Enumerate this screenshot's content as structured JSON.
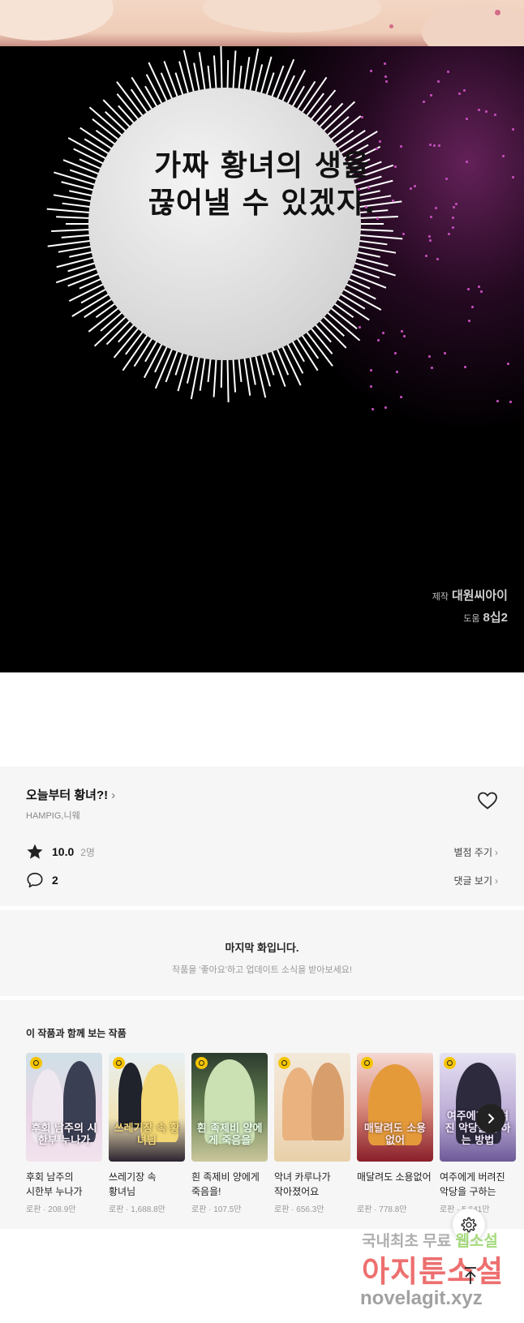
{
  "comic": {
    "bubble_line1": "가짜 황녀의 생을",
    "bubble_line2": "끊어낼 수 있겠지.",
    "credit_production_label": "제작",
    "credit_production_value": "대원씨아이",
    "credit_assist_label": "도움",
    "credit_assist_value": "8십2"
  },
  "work": {
    "title": "오늘부터 황녀?!",
    "authors": "HAMPIG,니웨",
    "rating": "10.0",
    "rating_count": "2명",
    "rate_action": "별점 주기",
    "comments": "2",
    "comments_action": "댓글 보기"
  },
  "last_episode": {
    "heading": "마지막 화입니다.",
    "subtext": "작품을 '좋아요'하고 업데이트 소식을 받아보세요!"
  },
  "recommendations": {
    "title": "이 작품과 함께 보는 작품",
    "items": [
      {
        "name": "후회 남주의 시한부 누나가 되었다",
        "genre": "로판",
        "views": "208.9만",
        "logo": "후회 남주의 시한부 누나가"
      },
      {
        "name": "쓰레기장 속 황녀님",
        "genre": "로판",
        "views": "1,688.8만",
        "logo": "쓰레기장 속 황녀님"
      },
      {
        "name": "흰 족제비 양에게 죽음을!",
        "genre": "로판",
        "views": "107.5만",
        "logo": "흰 족제비 양에게 죽음을"
      },
      {
        "name": "악녀 카루나가 작아졌어요",
        "genre": "로판",
        "views": "656.3만",
        "logo": ""
      },
      {
        "name": "매달려도 소용없어",
        "genre": "로판",
        "views": "778.8만",
        "logo": "매달려도 소용없어"
      },
      {
        "name": "여주에게 버려진 악당을 구하는",
        "genre": "로판",
        "views": "5,641만",
        "logo": "여주에게 버려진 악당을 구하는 방법"
      }
    ]
  },
  "watermark": {
    "line1_a": "국내최초 무료",
    "line1_b": "웹소설",
    "line2": "아지툰소설",
    "line3": "novelagit.xyz"
  },
  "colors": {
    "panel_bg": "#f6f6f6",
    "badge_yellow": "#f5c400",
    "watermark_red": "#e94c4c",
    "watermark_green": "#8fd15d"
  },
  "icons": [
    "heart-icon",
    "star-icon",
    "comment-icon",
    "chevron-right-icon",
    "clock-icon",
    "settings-icon",
    "arrow-up-icon"
  ]
}
